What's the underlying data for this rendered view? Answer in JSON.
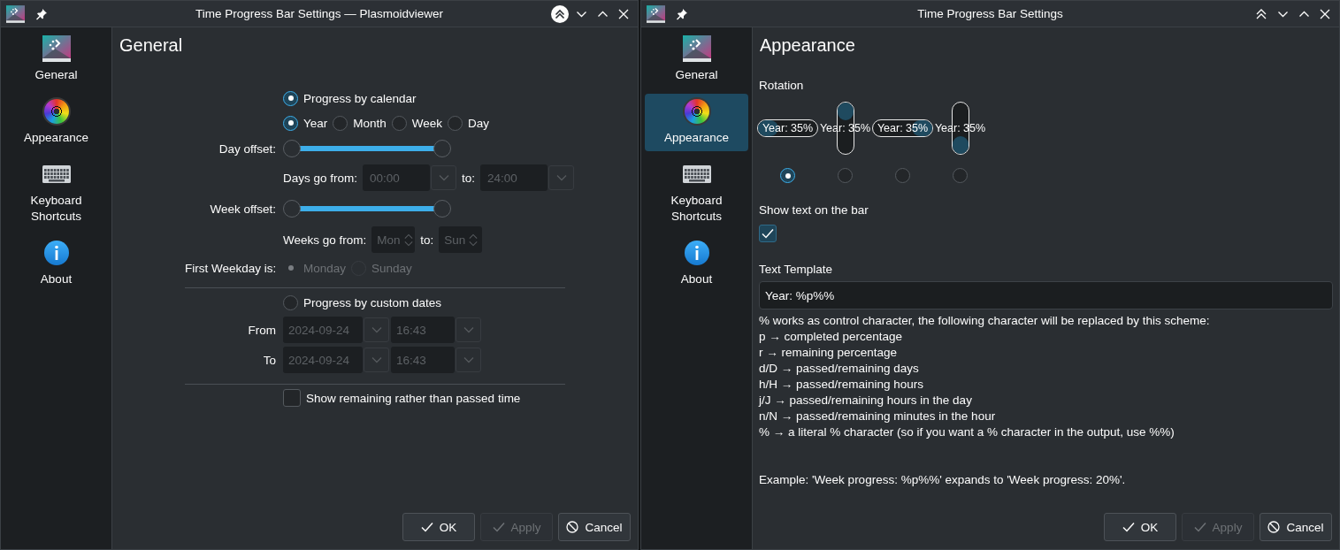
{
  "windows": [
    {
      "title": "Time Progress Bar Settings — Plasmoidviewer",
      "keep_above": true,
      "sidebar": {
        "items": [
          {
            "kind": "plasma",
            "label": "General",
            "selected": false
          },
          {
            "kind": "palette",
            "label": "Appearance",
            "selected": false
          },
          {
            "kind": "keyboard",
            "label": "Keyboard Shortcuts",
            "selected": false
          },
          {
            "kind": "info",
            "label": "About",
            "selected": false
          }
        ]
      },
      "page": {
        "kind": "general",
        "heading": "General",
        "calendar_mode": {
          "label": "Progress by calendar",
          "selected": true
        },
        "periods": [
          {
            "label": "Year",
            "selected": true
          },
          {
            "label": "Month",
            "selected": false
          },
          {
            "label": "Week",
            "selected": false
          },
          {
            "label": "Day",
            "selected": false
          }
        ],
        "day_offset": {
          "label": "Day offset:",
          "handles": [
            {
              "level": 0
            },
            {
              "level": 1
            }
          ]
        },
        "days_range": {
          "label": "Days go from:",
          "from": "00:00",
          "to_label": "to:",
          "to": "24:00",
          "disabled": true
        },
        "week_offset": {
          "label": "Week offset:",
          "handles": [
            {
              "level": 0
            },
            {
              "level": 1
            }
          ]
        },
        "weeks_range": {
          "label": "Weeks go from:",
          "from": "Mon",
          "to_label": "to:",
          "to": "Sun",
          "disabled": true
        },
        "first_weekday": {
          "label": "First Weekday is:",
          "disabled": true,
          "options": [
            {
              "label": "Monday",
              "selected": true
            },
            {
              "label": "Sunday",
              "selected": false
            }
          ]
        },
        "custom_mode": {
          "label": "Progress by custom dates",
          "selected": false
        },
        "custom_dates": {
          "disabled": true,
          "rows": [
            {
              "label": "From",
              "date": "2024-09-24",
              "time": "16:43"
            },
            {
              "label": "To",
              "date": "2024-09-24",
              "time": "16:43"
            }
          ]
        },
        "show_remaining": {
          "label": "Show remaining rather than passed time",
          "checked": false
        }
      },
      "buttons": [
        {
          "kind": "ok",
          "label": "OK",
          "disabled": false
        },
        {
          "kind": "apply",
          "label": "Apply",
          "disabled": true
        },
        {
          "kind": "cancel",
          "label": "Cancel",
          "disabled": false
        }
      ]
    },
    {
      "title": "Time Progress Bar Settings",
      "keep_above": false,
      "sidebar": {
        "items": [
          {
            "kind": "plasma",
            "label": "General",
            "selected": false
          },
          {
            "kind": "palette",
            "label": "Appearance",
            "selected": true
          },
          {
            "kind": "keyboard",
            "label": "Keyboard Shortcuts",
            "selected": false
          },
          {
            "kind": "info",
            "label": "About",
            "selected": false
          }
        ]
      },
      "page": {
        "kind": "appearance",
        "heading": "Appearance",
        "rotation": {
          "label": "Rotation",
          "options": [
            {
              "kind": "horizontal",
              "reversed": false,
              "text": "Year: 35%",
              "level": 0.35,
              "selected": true
            },
            {
              "kind": "vertical",
              "reversed": false,
              "text": "Year: 35%",
              "level": 0.35,
              "selected": false
            },
            {
              "kind": "horizontal",
              "reversed": true,
              "text": "Year: 35%",
              "level": 0.35,
              "selected": false
            },
            {
              "kind": "vertical",
              "reversed": true,
              "text": "Year: 35%",
              "level": 0.35,
              "selected": false
            }
          ]
        },
        "show_text": {
          "label": "Show text on the bar",
          "checked": true
        },
        "template": {
          "label": "Text Template",
          "value": "Year: %p%%"
        },
        "help_lines": [
          "% works as control character, the following character will be replaced by this scheme:",
          "p → completed percentage",
          "r → remaining percentage",
          "d/D → passed/remaining days",
          "h/H → passed/remaining hours",
          "j/J → passed/remaining hours in the day",
          "n/N → passed/remaining minutes in the hour",
          "% → a literal % character (so if you want a % character in the output, use %%)"
        ],
        "example": "Example: 'Week progress: %p%%' expands to 'Week progress: 20%'."
      },
      "buttons": [
        {
          "kind": "ok",
          "label": "OK",
          "disabled": false
        },
        {
          "kind": "apply",
          "label": "Apply",
          "disabled": true
        },
        {
          "kind": "cancel",
          "label": "Cancel",
          "disabled": false
        }
      ]
    }
  ]
}
